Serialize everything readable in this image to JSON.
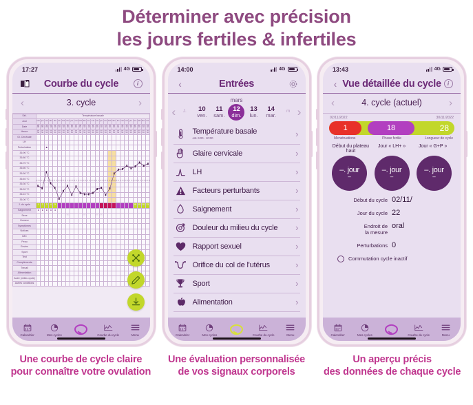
{
  "headline": {
    "line1": "Déterminer avec précision",
    "line2": "les jours fertiles & infertiles",
    "color": "#8e4a80"
  },
  "captions": [
    "Une courbe de cycle claire\npour connaître votre ovulation",
    "Une évaluation personnalisée\nde vos signaux corporels",
    "Un aperçu précis\ndes données de chaque cycle"
  ],
  "colors": {
    "accent_purple": "#6c2a77",
    "magenta": "#b23fc0",
    "lime": "#c2d72b",
    "red": "#e8312a",
    "caption_pink": "#c0378f",
    "phone_frame": "#e6cfe0",
    "tabbar": "#cbb2d8"
  },
  "phone1": {
    "status": {
      "time": "17:27",
      "network": "4G",
      "signal_label": "4G"
    },
    "header": {
      "title": "Courbe du cycle",
      "left_icon": "book-icon",
      "right_icon": "info-icon"
    },
    "cycle_selector": {
      "label": "3. cycle",
      "prev": "‹",
      "next": "›"
    },
    "chart_rows": {
      "sel": "Sél.",
      "section": "Température basale",
      "jour": "Jour",
      "date": "Date",
      "heure": "Heure",
      "gl_cervicale": "Gl. Cervicale",
      "lh": "LH",
      "perturbation": "Perturbation",
      "jour_cycle": "J. du cycle",
      "saignement": "Saignement",
      "sexe": "Sexe",
      "humeur": "Humeur",
      "symptomes": "Symptômes",
      "notices": "Notices",
      "imc": "IMC",
      "peau": "Peau",
      "envies": "Envies",
      "sport": "Sport",
      "test": "Test",
      "complements": "Compléments",
      "travail": "Travail",
      "alimentation": "Alimentation",
      "ligne1": "Autre (milieu cycle)",
      "ligne2": "Autres conditions"
    },
    "fabs": [
      "share-icon",
      "edit-icon",
      "download-icon"
    ],
    "tabs": [
      {
        "label": "Calendrier",
        "icon": "calendar-icon"
      },
      {
        "label": "Mes cycles",
        "icon": "pie-chart-icon"
      },
      {
        "label": "",
        "icon": "logo-icon"
      },
      {
        "label": "Courbe du cycle",
        "icon": "chart-line-icon"
      },
      {
        "label": "Menu",
        "icon": "menu-icon"
      }
    ],
    "chart_data": {
      "type": "line",
      "title": "Courbe du cycle — 3. cycle",
      "xlabel": "Jour du cycle",
      "ylabel": "Température basale (°C)",
      "ylim": [
        36.0,
        36.95
      ],
      "ytick_labels": [
        "36.90 °C",
        "36.80 °C",
        "36.70 °C",
        "36.60 °C",
        "36.50 °C",
        "36.40 °C",
        "36.30 °C",
        "36.20 °C",
        "36.10 °C",
        "36.00 °C"
      ],
      "coverline": 36.5,
      "fertile_band_days": [
        18,
        19
      ],
      "x": [
        1,
        2,
        3,
        4,
        5,
        6,
        7,
        8,
        9,
        10,
        11,
        12,
        13,
        14,
        15,
        16,
        17,
        18,
        19,
        20,
        21,
        22,
        23,
        24,
        25,
        26,
        27
      ],
      "values": [
        36.41,
        36.37,
        36.62,
        36.45,
        36.38,
        36.21,
        36.33,
        36.41,
        36.27,
        36.4,
        36.3,
        36.28,
        36.28,
        36.3,
        36.36,
        36.38,
        36.27,
        36.37,
        36.6,
        36.66,
        36.67,
        36.72,
        36.68,
        36.71,
        36.77,
        36.72,
        36.75
      ],
      "dates": [
        "28.09",
        "29.09",
        "30.09",
        "01.10",
        "02.10",
        "03.10",
        "04.10",
        "05.10",
        "06.10",
        "07.10",
        "08.10",
        "09.10",
        "10.10",
        "11.10",
        "12.10",
        "13.10",
        "14.10",
        "15.10",
        "16.10",
        "17.10",
        "18.10",
        "19.10",
        "20.10",
        "21.10",
        "22.10",
        "23.10",
        "24.10"
      ],
      "times": [
        "06:50",
        "06:50",
        "06:50",
        "06:50",
        "06:50",
        "06:50",
        "06:50",
        "06:50",
        "06:50",
        "06:50",
        "06:50",
        "06:50",
        "06:50",
        "06:50",
        "06:50",
        "06:50",
        "06:50",
        "06:50",
        "06:50",
        "06:50",
        "06:50",
        "06:50",
        "06:50",
        "06:50",
        "06:50",
        "06:50",
        "06:50"
      ],
      "weekdays": [
        "mer",
        "jeu",
        "ven",
        "sam",
        "dim",
        "lun",
        "mar",
        "mer",
        "jeu",
        "ven",
        "sam",
        "dim",
        "lun",
        "mar",
        "mer",
        "jeu",
        "ven",
        "sam",
        "dim",
        "lun",
        "mar",
        "mer",
        "jeu",
        "ven",
        "sam",
        "dim",
        "lun"
      ],
      "cycle_day_colors": [
        "#c2d72b",
        "#c2d72b",
        "#c2d72b",
        "#c2d72b",
        "#c2d72b",
        "#b23fc0",
        "#b23fc0",
        "#b23fc0",
        "#b23fc0",
        "#b23fc0",
        "#b23fc0",
        "#b23fc0",
        "#b23fc0",
        "#b23fc0",
        "#b23fc0",
        "#c4145a",
        "#c4145a",
        "#c4145a",
        "#c4145a",
        "#b23fc0",
        "#b23fc0",
        "#b23fc0",
        "#b23fc0",
        "#c2d72b",
        "#c2d72b",
        "#c2d72b",
        "#c2d72b"
      ],
      "cycle_day_numbers": [
        "1",
        "2",
        "3",
        "4",
        "5",
        "",
        "",
        "",
        "",
        "",
        "",
        "",
        "",
        "",
        "",
        "",
        "",
        "",
        "",
        "",
        "",
        "",
        "",
        "18",
        "19",
        "20",
        "21"
      ]
    }
  },
  "phone2": {
    "status": {
      "time": "14:00",
      "network": "4G"
    },
    "header": {
      "title": "Entrées",
      "left_icon": "chevron-left-icon",
      "right_icon": "gear-icon"
    },
    "month": "mars",
    "days": [
      {
        "num": "",
        "wd": "J.",
        "state": "faded"
      },
      {
        "num": "10",
        "wd": "ven.",
        "state": ""
      },
      {
        "num": "11",
        "wd": "sam.",
        "state": ""
      },
      {
        "num": "12",
        "wd": "dim.",
        "state": "sel"
      },
      {
        "num": "13",
        "wd": "lun.",
        "state": ""
      },
      {
        "num": "14",
        "wd": "mar.",
        "state": ""
      },
      {
        "num": "",
        "wd": "m",
        "state": "faded"
      }
    ],
    "entries": [
      {
        "label": "Température basale",
        "sub": "est. 6:00 - 10:00",
        "icon": "thermometer-icon"
      },
      {
        "label": "Glaire cervicale",
        "sub": "",
        "icon": "hand-icon"
      },
      {
        "label": "LH",
        "sub": "",
        "icon": "peak-curve-icon"
      },
      {
        "label": "Facteurs perturbants",
        "sub": "",
        "icon": "warning-icon"
      },
      {
        "label": "Saignement",
        "sub": "",
        "icon": "droplet-icon"
      },
      {
        "label": "Douleur du milieu du cycle",
        "sub": "",
        "icon": "target-icon"
      },
      {
        "label": "Rapport sexuel",
        "sub": "",
        "icon": "heart-icon"
      },
      {
        "label": "Orifice du col de l'utérus",
        "sub": "",
        "icon": "uterus-icon"
      },
      {
        "label": "Sport",
        "sub": "",
        "icon": "trophy-icon"
      },
      {
        "label": "Alimentation",
        "sub": "",
        "icon": "apple-icon"
      }
    ],
    "tabs": [
      {
        "label": "Calendrier",
        "icon": "calendar-icon"
      },
      {
        "label": "Mes cycles",
        "icon": "pie-chart-icon"
      },
      {
        "label": "",
        "icon": "logo-icon"
      },
      {
        "label": "Courbe du cycle",
        "icon": "chart-line-icon"
      },
      {
        "label": "Menu",
        "icon": "menu-icon"
      }
    ]
  },
  "phone3": {
    "status": {
      "time": "13:43",
      "network": "4G"
    },
    "header": {
      "title": "Vue détaillée du cycle",
      "left_icon": "chevron-left-icon",
      "right_icon": "info-icon"
    },
    "cycle_selector": {
      "label": "4. cycle (actuel)",
      "prev": "‹",
      "next": "›"
    },
    "bar": {
      "start_date": "02/11/2022",
      "end_date": "30/11/2022",
      "menstruation_value": "1",
      "fertile_value": "18",
      "length_value": "28",
      "legend": [
        "Menstruations",
        "Phase fertile",
        "Longueur de cycle"
      ]
    },
    "circle_labels": [
      "Début du plateau haut",
      "Jour « LH+ »",
      "Jour « G+P »"
    ],
    "circles": [
      {
        "main": "–. jour",
        "sub": "–"
      },
      {
        "main": "–. jour",
        "sub": "–"
      },
      {
        "main": "–. jour",
        "sub": "–"
      }
    ],
    "details": [
      {
        "key": "Début du cycle",
        "value": "02/11/"
      },
      {
        "key": "Jour du cycle",
        "value": "22"
      },
      {
        "key": "Endroit de\nla mesure",
        "value": "oral"
      },
      {
        "key": "Perturbations",
        "value": "0"
      }
    ],
    "toggle": {
      "label": "Commutation cycle inactif"
    },
    "tabs": [
      {
        "label": "Calendrier",
        "icon": "calendar-icon"
      },
      {
        "label": "Mes cycles",
        "icon": "pie-chart-icon"
      },
      {
        "label": "",
        "icon": "logo-icon"
      },
      {
        "label": "Courbe du cycle",
        "icon": "chart-line-icon"
      },
      {
        "label": "Menu",
        "icon": "menu-icon"
      }
    ]
  }
}
